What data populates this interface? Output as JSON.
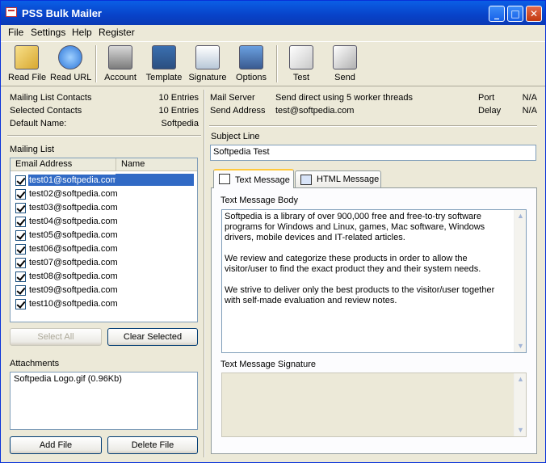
{
  "window": {
    "title": "PSS Bulk Mailer",
    "controls": {
      "minimize": "_",
      "maximize": "□",
      "close": "✕"
    }
  },
  "menu": [
    "File",
    "Settings",
    "Help",
    "Register"
  ],
  "toolbar": [
    {
      "label": "Read File",
      "icon": "folder-open-icon"
    },
    {
      "label": "Read URL",
      "icon": "internet-explorer-icon"
    },
    {
      "label": "Account",
      "icon": "account-icon"
    },
    {
      "label": "Template",
      "icon": "template-icon"
    },
    {
      "label": "Signature",
      "icon": "signature-icon"
    },
    {
      "label": "Options",
      "icon": "options-icon"
    },
    {
      "label": "Test",
      "icon": "envelope-icon"
    },
    {
      "label": "Send",
      "icon": "envelopes-icon"
    }
  ],
  "stats": {
    "list_contacts_label": "Mailing List Contacts",
    "list_contacts_value": "10 Entries",
    "selected_contacts_label": "Selected Contacts",
    "selected_contacts_value": "10 Entries",
    "default_name_label": "Default Name:",
    "default_name_value": "Softpedia"
  },
  "server": {
    "mail_server_label": "Mail Server",
    "mail_server_value": "Send direct using 5 worker threads",
    "send_address_label": "Send Address",
    "send_address_value": "test@softpedia.com",
    "port_label": "Port",
    "port_value": "N/A",
    "delay_label": "Delay",
    "delay_value": "N/A"
  },
  "mailing_list": {
    "label": "Mailing List",
    "col_email": "Email Address",
    "col_name": "Name",
    "rows": [
      "test01@softpedia.com",
      "test02@softpedia.com",
      "test03@softpedia.com",
      "test04@softpedia.com",
      "test05@softpedia.com",
      "test06@softpedia.com",
      "test07@softpedia.com",
      "test08@softpedia.com",
      "test09@softpedia.com",
      "test10@softpedia.com"
    ],
    "select_all": "Select All",
    "clear_selected": "Clear Selected"
  },
  "attachments": {
    "label": "Attachments",
    "items": [
      "Softpedia Logo.gif (0.96Kb)"
    ],
    "add_file": "Add File",
    "delete_file": "Delete File"
  },
  "subject": {
    "label": "Subject Line",
    "value": "Softpedia Test"
  },
  "tabs": {
    "text_message": "Text Message",
    "html_message": "HTML Message"
  },
  "body": {
    "label": "Text Message Body",
    "p1": "Softpedia is a library of over 900,000 free and free-to-try software programs for Windows and Linux, games, Mac software, Windows drivers, mobile devices and IT-related articles.",
    "p2": "We review and categorize these products in order to allow the visitor/user to find the exact product they and their system needs.",
    "p3": "We strive to deliver only the best products to the visitor/user together with self-made evaluation and review notes."
  },
  "signature": {
    "label": "Text Message Signature"
  }
}
